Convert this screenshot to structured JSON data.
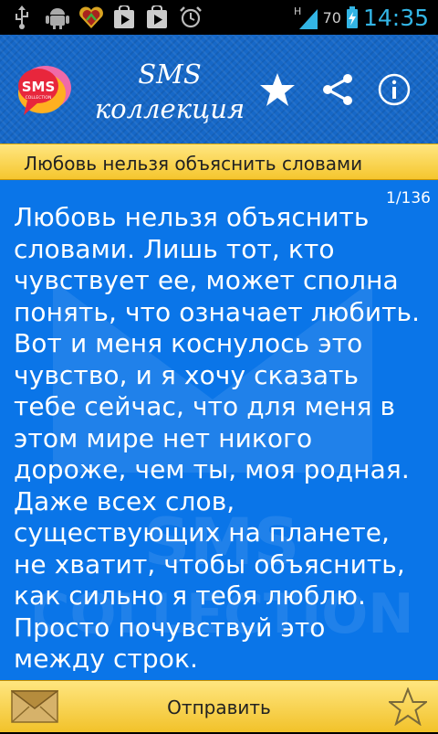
{
  "status_bar": {
    "battery_percent": "70",
    "time": "14:35",
    "icons": [
      "usb-icon",
      "android-debug-icon",
      "heart-app-icon",
      "play-store-icon",
      "play-store-icon",
      "alarm-icon",
      "signal-h-icon",
      "battery-charging-icon"
    ]
  },
  "header": {
    "title_line1": "SMS",
    "title_line2": "коллекция",
    "logo_text": "SMS",
    "logo_subtext": "COLLECTION",
    "actions": [
      "star-icon",
      "share-icon",
      "info-icon"
    ]
  },
  "subtitle": "Любовь нельзя объяснить словами",
  "main": {
    "counter": "1/136",
    "message": "Любовь нельзя объяснить словами. Лишь тот, кто чувствует ее, может сполна понять, что означает любить. Вот и меня коснулось это чувство, и я хочу сказать тебе сейчас, что для меня в этом мире нет никого дороже, чем ты, моя родная. Даже всех слов, существующих на планете, не хватит, чтобы объяснить, как сильно я тебя люблю. Просто почувствуй это между строк."
  },
  "bottom_bar": {
    "send_label": "Отправить"
  },
  "colors": {
    "header_blue": "#1668c8",
    "main_blue": "#0a75e8",
    "accent_yellow": "#f5c62e",
    "time_blue": "#33b5e5"
  }
}
